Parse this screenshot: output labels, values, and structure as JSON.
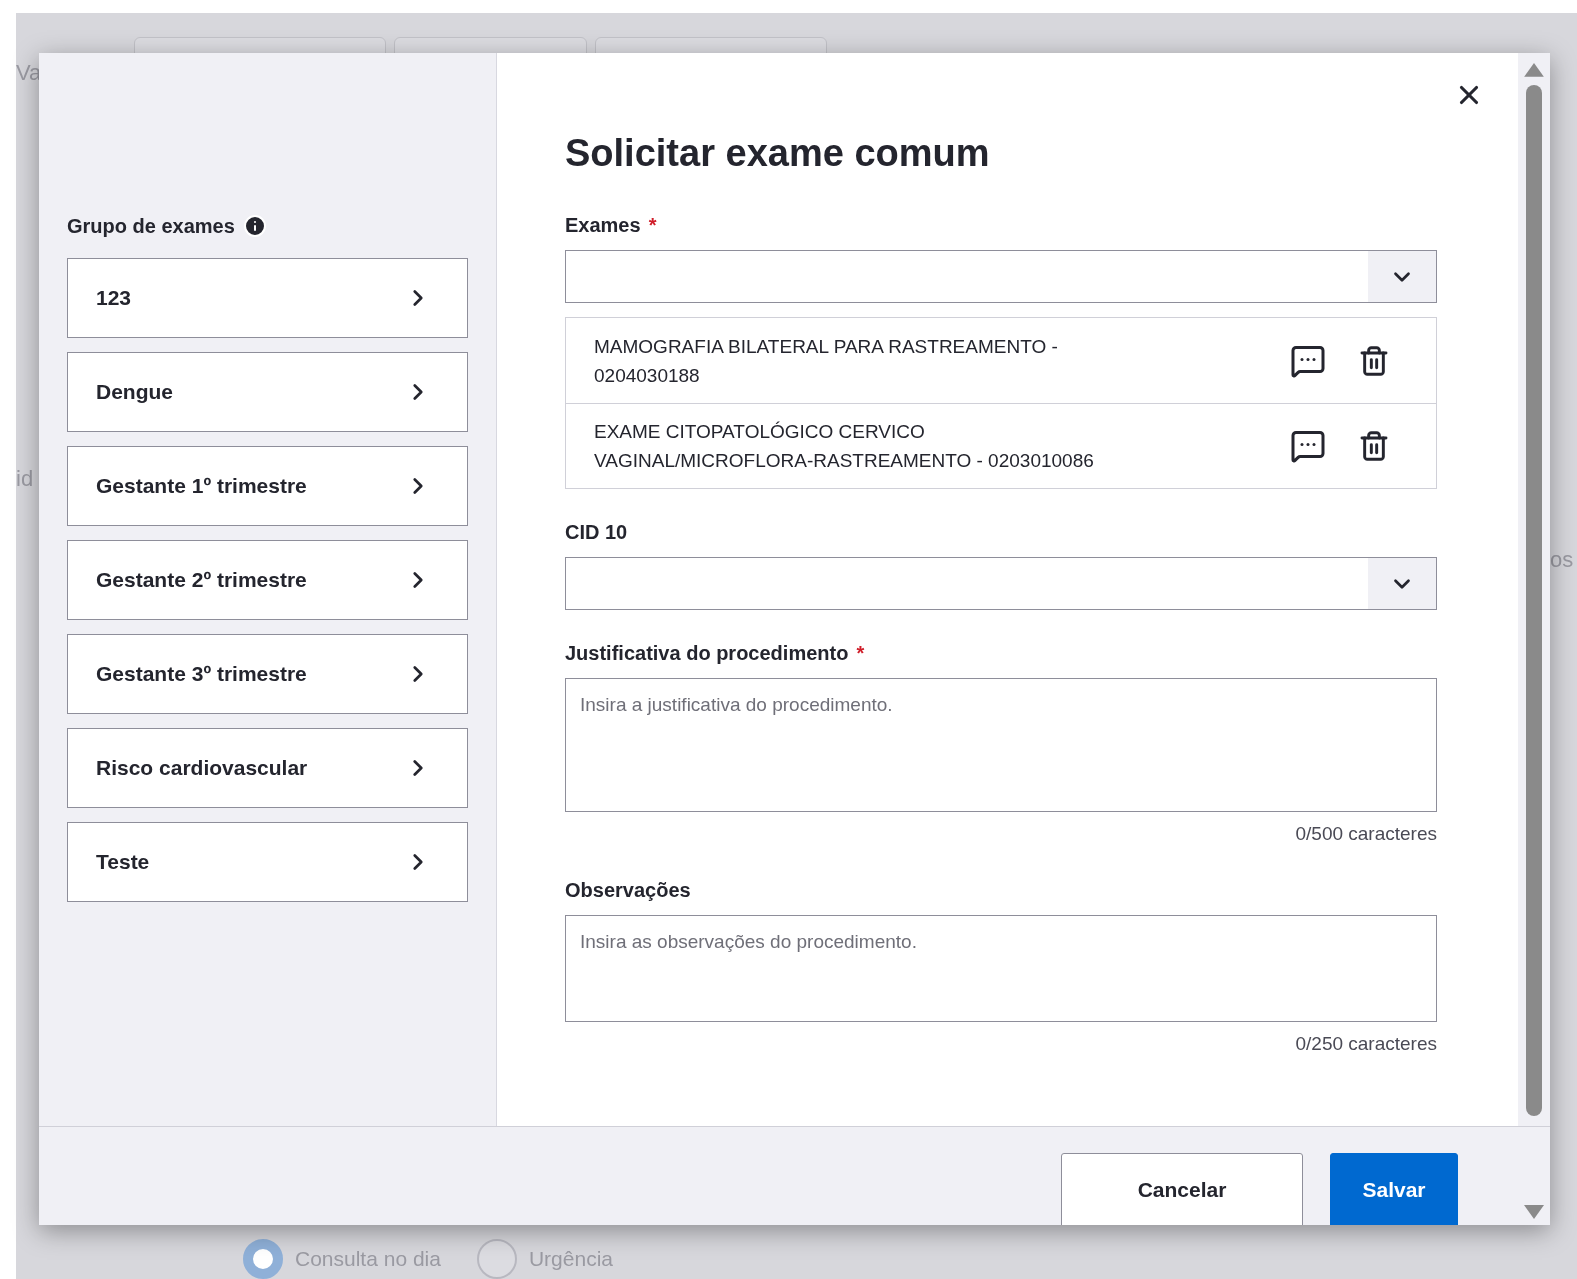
{
  "background": {
    "fragments": [
      "Va",
      "id",
      "os"
    ],
    "radios": [
      {
        "label": "Consulta no dia",
        "selected": true
      },
      {
        "label": "Urgência",
        "selected": false
      }
    ]
  },
  "groups": {
    "label": "Grupo de exames",
    "items": [
      "123",
      "Dengue",
      "Gestante 1º trimestre",
      "Gestante 2º trimestre",
      "Gestante 3º trimestre",
      "Risco cardiovascular",
      "Teste"
    ]
  },
  "dialog": {
    "title": "Solicitar exame comum"
  },
  "exams_field": {
    "label": "Exames",
    "required_mark": "*"
  },
  "selected_exams": [
    {
      "name": "MAMOGRAFIA BILATERAL PARA RASTREAMENTO - 0204030188"
    },
    {
      "name": "EXAME CITOPATOLÓGICO CERVICO VAGINAL/MICROFLORA-RASTREAMENTO - 0203010086"
    }
  ],
  "cid_field": {
    "label": "CID 10"
  },
  "justification": {
    "label": "Justificativa do procedimento",
    "required_mark": "*",
    "placeholder": "Insira a justificativa do procedimento.",
    "counter": "0/500 caracteres"
  },
  "observations": {
    "label": "Observações",
    "placeholder": "Insira as observações do procedimento.",
    "counter": "0/250 caracteres"
  },
  "buttons": [
    {
      "label": "Cancelar",
      "kind": "secondary"
    },
    {
      "label": "Salvar",
      "kind": "primary"
    }
  ]
}
